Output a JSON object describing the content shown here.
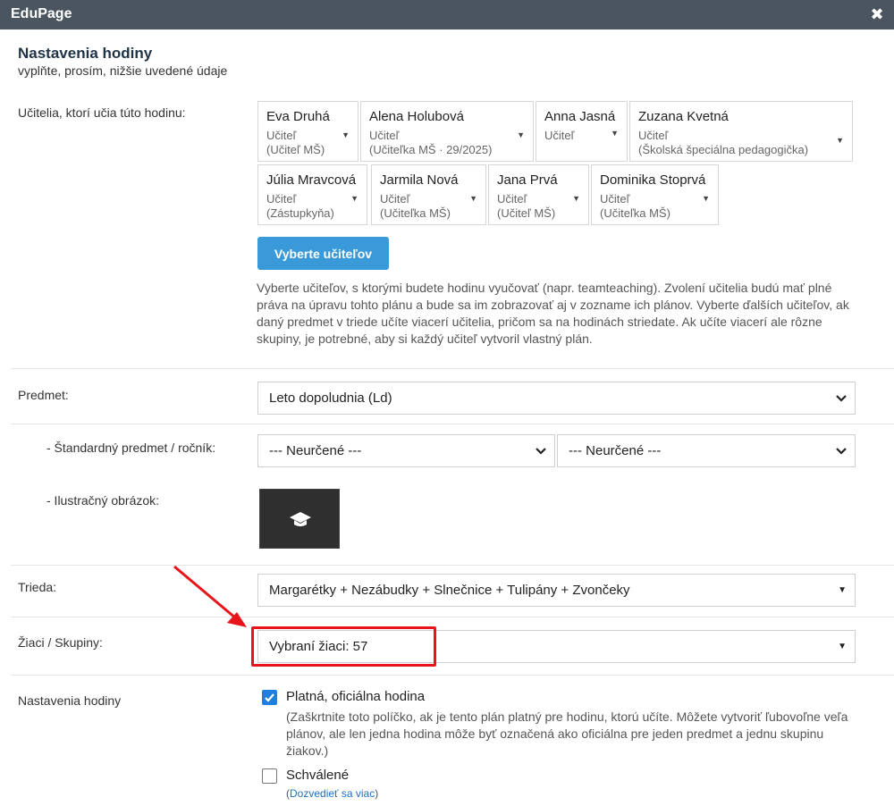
{
  "window": {
    "title": "EduPage",
    "close_glyph": "✖"
  },
  "header": {
    "title": "Nastavenia hodiny",
    "subtitle": "vyplňte, prosím, nižšie uvedené údaje"
  },
  "teachers": {
    "label": "Učitelia, ktorí učia túto hodinu:",
    "cards": [
      {
        "name": "Eva Druhá",
        "role": "Učiteľ",
        "detail": "(Učiteľ MŠ)"
      },
      {
        "name": "Alena Holubová",
        "role": "Učiteľ",
        "detail": "(Učiteľka MŠ · 29/2025)"
      },
      {
        "name": "Anna Jasná",
        "role": "Učiteľ",
        "detail": ""
      },
      {
        "name": "Zuzana Kvetná",
        "role": "Učiteľ",
        "detail": "(Školská špeciálna pedagogička)"
      },
      {
        "name": "Júlia Mravcová",
        "role": "Učiteľ",
        "detail": "(Zástupkyňa)"
      },
      {
        "name": "Jarmila Nová",
        "role": "Učiteľ",
        "detail": "(Učiteľka MŠ)"
      },
      {
        "name": "Jana Prvá",
        "role": "Učiteľ",
        "detail": "(Učiteľ MŠ)"
      },
      {
        "name": "Dominika Stoprvá",
        "role": "Učiteľ",
        "detail": "(Učiteľka MŠ)"
      }
    ],
    "select_button": "Vyberte učiteľov",
    "help": "Vyberte učiteľov, s ktorými budete hodinu vyučovať (napr. teamteaching). Zvolení učitelia budú mať plné práva na úpravu tohto plánu a bude sa im zobrazovať aj v zozname ich plánov. Vyberte ďalších učiteľov, ak daný predmet v triede učíte viacerí učitelia, pričom sa na hodinách striedate. Ak učíte viacerí ale rôzne skupiny, je potrebné, aby si každý učiteľ vytvoril vlastný plán."
  },
  "subject": {
    "label": "Predmet:",
    "value": "Leto dopoludnia (Ld)"
  },
  "standard": {
    "label": "- Štandardný predmet / ročník:",
    "subject_value": "--- Neurčené ---",
    "grade_value": "--- Neurčené ---"
  },
  "illustration": {
    "label": "- Ilustračný obrázok:",
    "icon": "graduation-cap-icon"
  },
  "class_field": {
    "label": "Trieda:",
    "value": "Margarétky + Nezábudky + Slnečnice + Tulipány + Zvončeky"
  },
  "students": {
    "label": "Žiaci / Skupiny:",
    "value": "Vybraní žiaci: 57"
  },
  "lesson_settings": {
    "label": "Nastavenia hodiny",
    "official_label": "Platná, oficiálna hodina",
    "official_checked": true,
    "official_note": "(Zaškrtnite toto políčko, ak je tento plán platný pre hodinu, ktorú učíte. Môžete vytvoriť ľubovoľne veľa plánov, ale len jedna hodina môže byť označená ako oficiálna pre jeden predmet a jednu skupinu žiakov.)",
    "approved_label": "Schválené",
    "approved_checked": false,
    "learn_open": "(",
    "learn_more": "Dozvedieť sa viac",
    "learn_close": ")"
  },
  "colors": {
    "titlebar": "#4a5560",
    "primary": "#3a9ad9",
    "highlight": "#e8141b",
    "checkbox": "#1f7ee0"
  }
}
